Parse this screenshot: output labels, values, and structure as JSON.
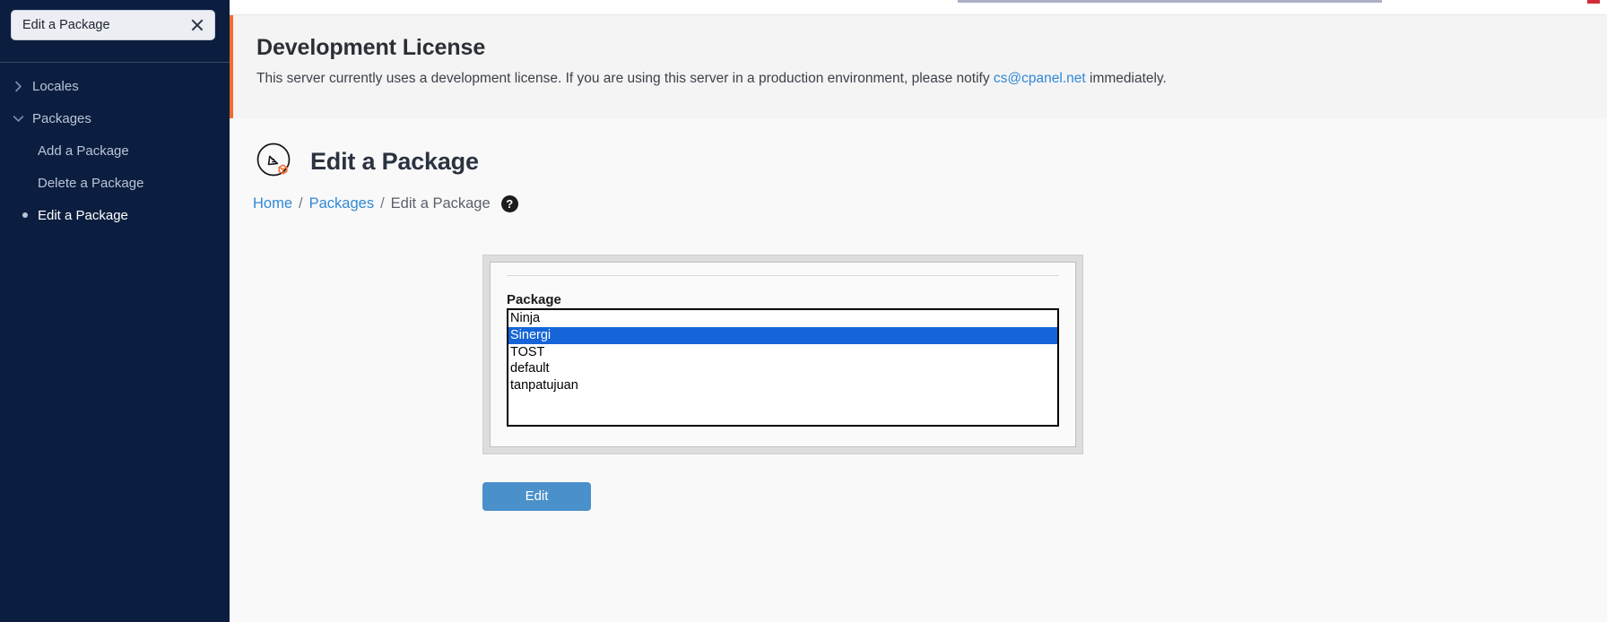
{
  "sidebar": {
    "search": {
      "value": "Edit a Package",
      "placeholder": "Search",
      "clear_label": "Clear search"
    },
    "groups": [
      {
        "label": "Locales",
        "expanded": false,
        "chevron": "chevron-right-icon"
      },
      {
        "label": "Packages",
        "expanded": true,
        "chevron": "chevron-down-icon"
      }
    ],
    "items": [
      {
        "label": "Add a Package",
        "active": false
      },
      {
        "label": "Delete a Package",
        "active": false
      },
      {
        "label": "Edit a Package",
        "active": true
      }
    ]
  },
  "notice": {
    "title": "Development License",
    "text_before": "This server currently uses a development license. If you are using this server in a production environment, please notify ",
    "link": "cs@cpanel.net",
    "text_after": " immediately."
  },
  "page": {
    "icon": "edit-package-icon",
    "title": "Edit a Package",
    "breadcrumb": {
      "home": "Home",
      "packages": "Packages",
      "current": "Edit a Package",
      "sep": "/",
      "help": "?"
    }
  },
  "form": {
    "field_label": "Package",
    "options": [
      {
        "label": "Ninja",
        "selected": false
      },
      {
        "label": "Sinergi",
        "selected": true
      },
      {
        "label": "TOST",
        "selected": false
      },
      {
        "label": "default",
        "selected": false
      },
      {
        "label": "tanpatujuan",
        "selected": false
      }
    ],
    "selected_value": "Sinergi",
    "submit_label": "Edit"
  },
  "colors": {
    "sidebar_bg": "#0b1e3f",
    "notice_accent": "#f26c30",
    "link": "#2f88d6",
    "selection": "#1565d8",
    "button": "#4a90cb"
  }
}
